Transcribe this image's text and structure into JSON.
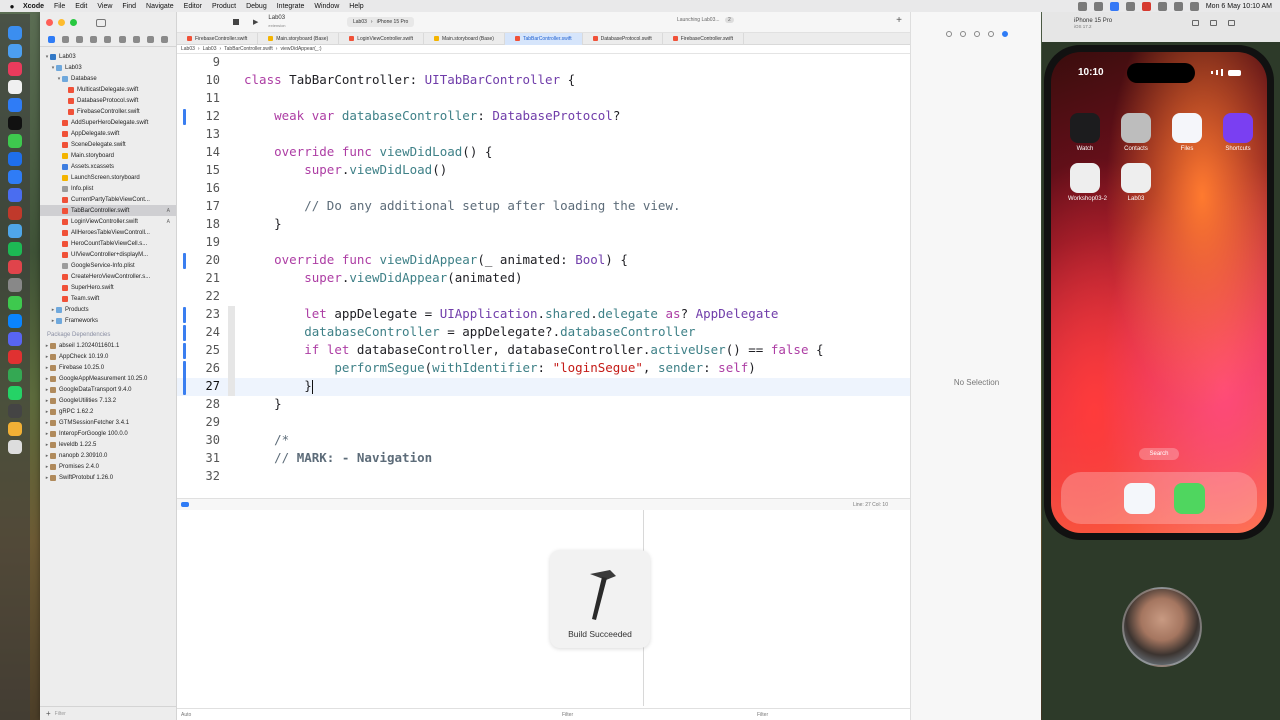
{
  "menubar": {
    "app": "Xcode",
    "items": [
      "File",
      "Edit",
      "View",
      "Find",
      "Navigate",
      "Editor",
      "Product",
      "Debug",
      "Integrate",
      "Window",
      "Help"
    ],
    "clock": "Mon 6 May  10:10 AM"
  },
  "navigator": {
    "project_rows": [
      {
        "label": "Lab03",
        "indent": 0,
        "icon": "proj",
        "chevron": "▾"
      },
      {
        "label": "Lab03",
        "indent": 1,
        "icon": "folder",
        "chevron": "▾"
      },
      {
        "label": "Database",
        "indent": 2,
        "icon": "folder",
        "chevron": "▾"
      },
      {
        "label": "MulticastDelegate.swift",
        "indent": 3,
        "icon": "swift",
        "chevron": ""
      },
      {
        "label": "DatabaseProtocol.swift",
        "indent": 3,
        "icon": "swift",
        "chevron": ""
      },
      {
        "label": "FirebaseController.swift",
        "indent": 3,
        "icon": "swift",
        "chevron": ""
      },
      {
        "label": "AddSuperHeroDelegate.swift",
        "indent": 2,
        "icon": "swift",
        "chevron": ""
      },
      {
        "label": "AppDelegate.swift",
        "indent": 2,
        "icon": "swift",
        "chevron": ""
      },
      {
        "label": "SceneDelegate.swift",
        "indent": 2,
        "icon": "swift",
        "chevron": ""
      },
      {
        "label": "Main.storyboard",
        "indent": 2,
        "icon": "sb",
        "chevron": ""
      },
      {
        "label": "Assets.xcassets",
        "indent": 2,
        "icon": "assets",
        "chevron": ""
      },
      {
        "label": "LaunchScreen.storyboard",
        "indent": 2,
        "icon": "sb",
        "chevron": ""
      },
      {
        "label": "Info.plist",
        "indent": 2,
        "icon": "plist",
        "chevron": ""
      },
      {
        "label": "CurrentPartyTableViewCont...",
        "indent": 2,
        "icon": "swift",
        "chevron": ""
      },
      {
        "label": "TabBarController.swift",
        "indent": 2,
        "icon": "swift",
        "chevron": "",
        "selected": true,
        "badge": "A"
      },
      {
        "label": "LoginViewController.swift",
        "indent": 2,
        "icon": "swift",
        "chevron": "",
        "badge": "A"
      },
      {
        "label": "AllHeroesTableViewControll...",
        "indent": 2,
        "icon": "swift",
        "chevron": ""
      },
      {
        "label": "HeroCountTableViewCell.s...",
        "indent": 2,
        "icon": "swift",
        "chevron": ""
      },
      {
        "label": "UIViewController+displayM...",
        "indent": 2,
        "icon": "swift",
        "chevron": ""
      },
      {
        "label": "GoogleService-Info.plist",
        "indent": 2,
        "icon": "plist",
        "chevron": ""
      },
      {
        "label": "CreateHeroViewController.s...",
        "indent": 2,
        "icon": "swift",
        "chevron": ""
      },
      {
        "label": "SuperHero.swift",
        "indent": 2,
        "icon": "swift",
        "chevron": ""
      },
      {
        "label": "Team.swift",
        "indent": 2,
        "icon": "swift",
        "chevron": ""
      },
      {
        "label": "Products",
        "indent": 1,
        "icon": "folder",
        "chevron": "▸"
      },
      {
        "label": "Frameworks",
        "indent": 1,
        "icon": "folder",
        "chevron": "▸"
      }
    ],
    "packages_header": "Package Dependencies",
    "packages": [
      "abseil 1.2024011601.1",
      "AppCheck 10.19.0",
      "Firebase 10.25.0",
      "GoogleAppMeasurement 10.25.0",
      "GoogleDataTransport 9.4.0",
      "GoogleUtilities 7.13.2",
      "gRPC 1.62.2",
      "GTMSessionFetcher 3.4.1",
      "InteropForGoogle 100.0.0",
      "leveldb 1.22.5",
      "nanopb 2.30910.0",
      "Promises 2.4.0",
      "SwiftProtobuf 1.26.0"
    ],
    "filter_placeholder": "Filter"
  },
  "toolbar": {
    "project": "Lab03",
    "project_sub": "extension",
    "scheme": "Lab03",
    "device": "iPhone 15 Pro",
    "status": "Launching Lab03...",
    "status_count": "2"
  },
  "tabs": [
    {
      "label": "FirebaseController.swift",
      "type": "swift"
    },
    {
      "label": "Main.storyboard (Base)",
      "type": "sb"
    },
    {
      "label": "LoginViewController.swift",
      "type": "swift"
    },
    {
      "label": "Main.storyboard (Base)",
      "type": "sb"
    },
    {
      "label": "TabBarController.swift",
      "type": "swift",
      "active": true
    },
    {
      "label": "DatabaseProtocol.swift",
      "type": "swift"
    },
    {
      "label": "FirebaseController.swift",
      "type": "swift"
    }
  ],
  "jumpbar": [
    "Lab03",
    "Lab03",
    "TabBarController.swift",
    "viewDidAppear(_:)"
  ],
  "code": {
    "lines": [
      {
        "n": "9",
        "html": ""
      },
      {
        "n": "10",
        "html": "<span class='kw'>class</span> TabBarController: <span class='ty'>UITabBarController</span> {"
      },
      {
        "n": "11",
        "html": ""
      },
      {
        "n": "12",
        "html": "    <span class='kw'>weak</span> <span class='kw'>var</span> <span class='prop'>databaseController</span>: <span class='ty'>DatabaseProtocol</span>?"
      },
      {
        "n": "13",
        "html": ""
      },
      {
        "n": "14",
        "html": "    <span class='kw'>override</span> <span class='kw'>func</span> <span class='fn'>viewDidLoad</span>() {"
      },
      {
        "n": "15",
        "html": "        <span class='kw'>super</span>.<span class='fn'>viewDidLoad</span>()"
      },
      {
        "n": "16",
        "html": ""
      },
      {
        "n": "17",
        "html": "        <span class='cmt'>// Do any additional setup after loading the view.</span>"
      },
      {
        "n": "18",
        "html": "    }"
      },
      {
        "n": "19",
        "html": ""
      },
      {
        "n": "20",
        "html": "    <span class='kw'>override</span> <span class='kw'>func</span> <span class='fn'>viewDidAppear</span>(_ animated: <span class='ty'>Bool</span>) {"
      },
      {
        "n": "21",
        "html": "        <span class='kw'>super</span>.<span class='fn'>viewDidAppear</span>(animated)"
      },
      {
        "n": "22",
        "html": ""
      },
      {
        "n": "23",
        "html": "        <span class='kw'>let</span> appDelegate = <span class='ty'>UIApplication</span>.<span class='prop'>shared</span>.<span class='prop'>delegate</span> <span class='kw'>as</span>? <span class='ty'>AppDelegate</span>"
      },
      {
        "n": "24",
        "html": "        <span class='prop'>databaseController</span> = appDelegate?.<span class='prop'>databaseController</span>"
      },
      {
        "n": "25",
        "html": "        <span class='kw'>if</span> <span class='kw'>let</span> databaseController, databaseController.<span class='fn'>activeUser</span>() == <span class='kw'>false</span> {"
      },
      {
        "n": "26",
        "html": "            <span class='fn'>performSegue</span>(<span class='fn'>withIdentifier</span>: <span class='str'>\"loginSegue\"</span>, <span class='fn'>sender</span>: <span class='kw'>self</span>)"
      },
      {
        "n": "27",
        "html": "        }"
      },
      {
        "n": "28",
        "html": "    }"
      },
      {
        "n": "29",
        "html": ""
      },
      {
        "n": "30",
        "html": "    <span class='cmt'>/*</span>"
      },
      {
        "n": "31",
        "html": "    <span class='cmt'>// </span><span class='cmt bold'>MARK: - Navigation</span>"
      },
      {
        "n": "32",
        "html": ""
      }
    ],
    "current_line": "27"
  },
  "status_bar": {
    "position": "Line: 27  Col: 10"
  },
  "build": {
    "label": "Build Succeeded"
  },
  "debug": {
    "auto_label": "Auto",
    "filter_placeholder": "Filter"
  },
  "inspector": {
    "empty": "No Selection"
  },
  "simulator": {
    "title": "iPhone 15 Pro",
    "subtitle": "iOS 17.2",
    "time": "10:10",
    "apps": [
      {
        "label": "Watch",
        "color": "#1c1c1e"
      },
      {
        "label": "Contacts",
        "color": "#bdbdbd"
      },
      {
        "label": "Files",
        "color": "#f5f6fa"
      },
      {
        "label": "Shortcuts",
        "color": "#7a3ff2"
      },
      {
        "label": "Workshop03-2",
        "color": "#eeeeee"
      },
      {
        "label": "Lab03",
        "color": "#eeeeee"
      }
    ],
    "search": "Search",
    "dock_apps": [
      {
        "name": "safari",
        "color": "#f4f7fb"
      },
      {
        "name": "messages",
        "color": "#4fd65f"
      }
    ]
  },
  "colors": {
    "accent": "#2f7cf6",
    "keyword": "#ad3da4",
    "type": "#703daa",
    "function": "#3e8087",
    "string": "#c41a16",
    "comment": "#5d6c79"
  }
}
